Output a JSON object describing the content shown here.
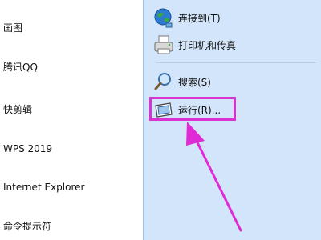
{
  "left_menu": {
    "items": [
      {
        "label": "画图"
      },
      {
        "label": "腾讯QQ"
      },
      {
        "label": "快剪辑"
      },
      {
        "label": "WPS 2019"
      },
      {
        "label": "Internet Explorer"
      },
      {
        "label": "命令提示符"
      }
    ]
  },
  "right_menu": {
    "items": [
      {
        "label": "连接到(T)",
        "icon": "network-globe-icon"
      },
      {
        "label": "打印机和传真",
        "icon": "printer-icon"
      },
      {
        "label": "搜索(S)",
        "icon": "search-icon"
      },
      {
        "label": "运行(R)...",
        "icon": "run-icon"
      }
    ]
  },
  "annotation": {
    "highlight_color": "#d633d0",
    "arrow_color": "#e02ad6",
    "target": "运行(R)..."
  },
  "colors": {
    "right_pane_bg": "#d3e5fa",
    "left_pane_bg": "#ffffff"
  }
}
